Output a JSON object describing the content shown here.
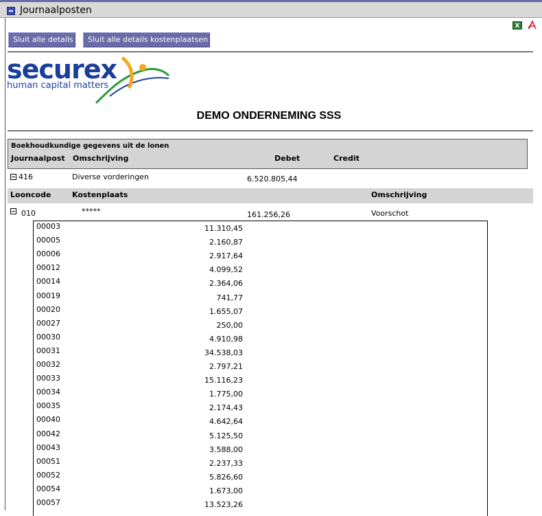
{
  "panel": {
    "title": "Journaalposten"
  },
  "toolbar": {
    "close_details_label": "Sluit alle details",
    "close_cost_details_label": "Sluit alle details kostenplaatsen",
    "excel_icon": "excel-icon",
    "pdf_icon": "pdf-icon"
  },
  "logo": {
    "brand": "securex",
    "tagline": "human capital matters",
    "color": "#1a3f9a",
    "accent": "#f5a623"
  },
  "company": "DEMO ONDERNEMING SSS",
  "header": {
    "title": "Boekhoudkundige gegevens uit de lonen",
    "columns": [
      "Journaalpost",
      "Omschrijving",
      "Debet",
      "Credit"
    ]
  },
  "journal_entry": {
    "code": "416",
    "description": "Diverse vorderingen",
    "debet": "6.520.805,44"
  },
  "loon_header": {
    "columns": [
      "Looncode",
      "Kostenplaats",
      "Omschrijving"
    ]
  },
  "loon_entry": {
    "code": "010",
    "kostenplaats": "*****",
    "amount": "161.256,26",
    "description": "Voorschot"
  },
  "details": [
    {
      "code": "00003",
      "amount": "11.310,45"
    },
    {
      "code": "00005",
      "amount": "2.160,87"
    },
    {
      "code": "00006",
      "amount": "2.917,64"
    },
    {
      "code": "00012",
      "amount": "4.099,52"
    },
    {
      "code": "00014",
      "amount": "2.364,06"
    },
    {
      "code": "00019",
      "amount": "741,77"
    },
    {
      "code": "00020",
      "amount": "1.655,07"
    },
    {
      "code": "00027",
      "amount": "250,00"
    },
    {
      "code": "00030",
      "amount": "4.910,98"
    },
    {
      "code": "00031",
      "amount": "34.538,03"
    },
    {
      "code": "00032",
      "amount": "2.797,21"
    },
    {
      "code": "00033",
      "amount": "15.116,23"
    },
    {
      "code": "00034",
      "amount": "1.775,00"
    },
    {
      "code": "00035",
      "amount": "2.174,43"
    },
    {
      "code": "00040",
      "amount": "4.642,64"
    },
    {
      "code": "00042",
      "amount": "5.125,50"
    },
    {
      "code": "00043",
      "amount": "3.588,00"
    },
    {
      "code": "00051",
      "amount": "2.237,33"
    },
    {
      "code": "00052",
      "amount": "5.826,60"
    },
    {
      "code": "00054",
      "amount": "1.673,00"
    },
    {
      "code": "00057",
      "amount": "13.523,26"
    }
  ]
}
